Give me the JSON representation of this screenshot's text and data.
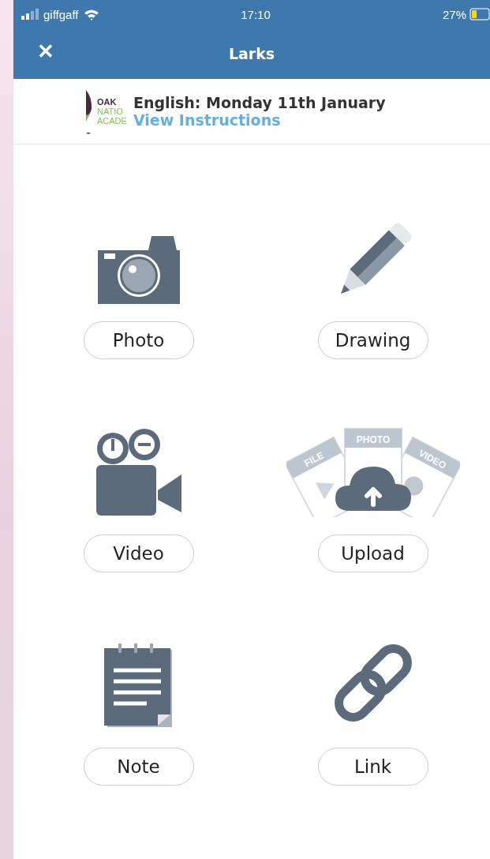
{
  "status_bar": {
    "carrier": "giffgaff",
    "time": "17:10",
    "battery": "27%"
  },
  "nav": {
    "close": "✕",
    "title": "Larks"
  },
  "header": {
    "logo": [
      "OAK",
      "NATIO",
      "ACADE"
    ],
    "title": "English: Monday 11th January",
    "link": "View Instructions"
  },
  "items": [
    {
      "kind": "camera",
      "label": "Photo"
    },
    {
      "kind": "pencil",
      "label": "Drawing"
    },
    {
      "kind": "video",
      "label": "Video"
    },
    {
      "kind": "upload",
      "label": "Upload",
      "icon_labels": [
        "FILE",
        "PHOTO",
        "VIDEO"
      ]
    },
    {
      "kind": "note",
      "label": "Note"
    },
    {
      "kind": "link",
      "label": "Link"
    }
  ]
}
